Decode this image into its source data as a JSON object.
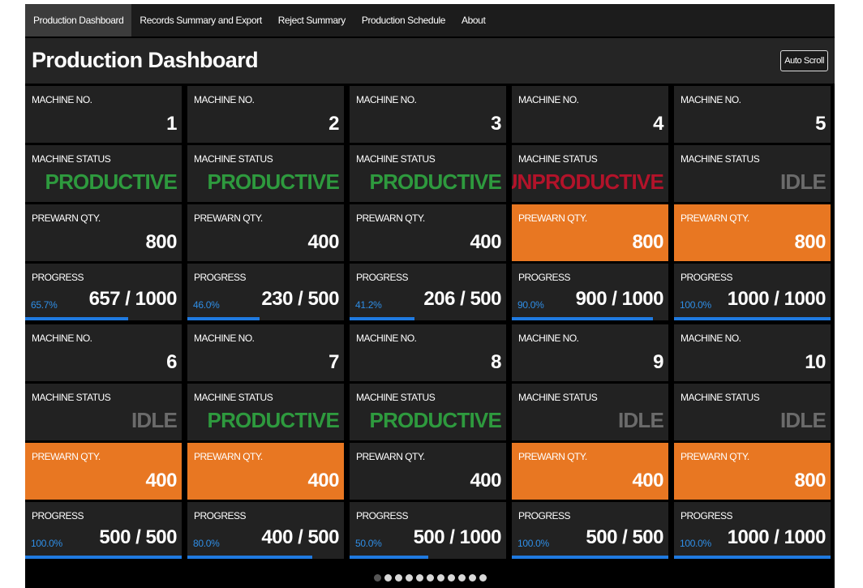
{
  "nav": {
    "items": [
      {
        "label": "Production Dashboard",
        "active": true
      },
      {
        "label": "Records Summary and Export",
        "active": false
      },
      {
        "label": "Reject Summary",
        "active": false
      },
      {
        "label": "Production Schedule",
        "active": false
      },
      {
        "label": "About",
        "active": false
      }
    ]
  },
  "header": {
    "title": "Production Dashboard",
    "auto_scroll_label": "Auto Scroll"
  },
  "labels": {
    "machine_no": "MACHINE NO.",
    "machine_status": "MACHINE STATUS",
    "prewarn_qty": "PREWARN QTY.",
    "progress": "PROGRESS"
  },
  "colors": {
    "productive": "#2e9a3e",
    "unproductive": "#b3132a",
    "idle": "#6b6b6b",
    "prewarn": "#e87722",
    "progress": "#1f7ae0"
  },
  "machines": [
    {
      "no": "1",
      "status": "PRODUCTIVE",
      "prewarn": "800",
      "prewarn_alert": false,
      "percent": "65.7%",
      "fraction": 0.657,
      "progress": "657 / 1000"
    },
    {
      "no": "2",
      "status": "PRODUCTIVE",
      "prewarn": "400",
      "prewarn_alert": false,
      "percent": "46.0%",
      "fraction": 0.46,
      "progress": "230 / 500"
    },
    {
      "no": "3",
      "status": "PRODUCTIVE",
      "prewarn": "400",
      "prewarn_alert": false,
      "percent": "41.2%",
      "fraction": 0.412,
      "progress": "206 / 500"
    },
    {
      "no": "4",
      "status": "UNPRODUCTIVE",
      "prewarn": "800",
      "prewarn_alert": true,
      "percent": "90.0%",
      "fraction": 0.9,
      "progress": "900 / 1000"
    },
    {
      "no": "5",
      "status": "IDLE",
      "prewarn": "800",
      "prewarn_alert": true,
      "percent": "100.0%",
      "fraction": 1.0,
      "progress": "1000 / 1000"
    },
    {
      "no": "6",
      "status": "IDLE",
      "prewarn": "400",
      "prewarn_alert": true,
      "percent": "100.0%",
      "fraction": 1.0,
      "progress": "500 / 500"
    },
    {
      "no": "7",
      "status": "PRODUCTIVE",
      "prewarn": "400",
      "prewarn_alert": true,
      "percent": "80.0%",
      "fraction": 0.8,
      "progress": "400 / 500"
    },
    {
      "no": "8",
      "status": "PRODUCTIVE",
      "prewarn": "400",
      "prewarn_alert": false,
      "percent": "50.0%",
      "fraction": 0.5,
      "progress": "500 / 1000"
    },
    {
      "no": "9",
      "status": "IDLE",
      "prewarn": "400",
      "prewarn_alert": true,
      "percent": "100.0%",
      "fraction": 1.0,
      "progress": "500 / 500"
    },
    {
      "no": "10",
      "status": "IDLE",
      "prewarn": "800",
      "prewarn_alert": true,
      "percent": "100.0%",
      "fraction": 1.0,
      "progress": "1000 / 1000"
    }
  ],
  "pagination": {
    "count": 11,
    "active_index": 0
  }
}
